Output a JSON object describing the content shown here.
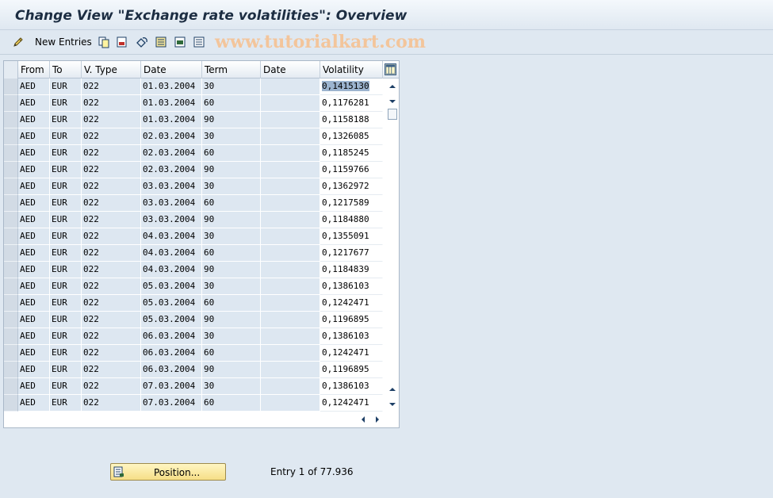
{
  "window": {
    "title": "Change View \"Exchange rate volatilities\": Overview"
  },
  "toolbar": {
    "new_entries_label": "New Entries",
    "watermark": "www.tutorialkart.com",
    "icons": [
      "edit-pencil-icon",
      "copy-icon",
      "delete-icon",
      "undo-icon",
      "select-all-icon",
      "select-block-icon",
      "deselect-all-icon"
    ]
  },
  "table": {
    "columns": [
      "From",
      "To",
      "V. Type",
      "Date",
      "Term",
      "Date",
      "Volatility"
    ],
    "rows": [
      [
        "AED",
        "EUR",
        "022",
        "01.03.2004",
        "30",
        "",
        "0,1415130"
      ],
      [
        "AED",
        "EUR",
        "022",
        "01.03.2004",
        "60",
        "",
        "0,1176281"
      ],
      [
        "AED",
        "EUR",
        "022",
        "01.03.2004",
        "90",
        "",
        "0,1158188"
      ],
      [
        "AED",
        "EUR",
        "022",
        "02.03.2004",
        "30",
        "",
        "0,1326085"
      ],
      [
        "AED",
        "EUR",
        "022",
        "02.03.2004",
        "60",
        "",
        "0,1185245"
      ],
      [
        "AED",
        "EUR",
        "022",
        "02.03.2004",
        "90",
        "",
        "0,1159766"
      ],
      [
        "AED",
        "EUR",
        "022",
        "03.03.2004",
        "30",
        "",
        "0,1362972"
      ],
      [
        "AED",
        "EUR",
        "022",
        "03.03.2004",
        "60",
        "",
        "0,1217589"
      ],
      [
        "AED",
        "EUR",
        "022",
        "03.03.2004",
        "90",
        "",
        "0,1184880"
      ],
      [
        "AED",
        "EUR",
        "022",
        "04.03.2004",
        "30",
        "",
        "0,1355091"
      ],
      [
        "AED",
        "EUR",
        "022",
        "04.03.2004",
        "60",
        "",
        "0,1217677"
      ],
      [
        "AED",
        "EUR",
        "022",
        "04.03.2004",
        "90",
        "",
        "0,1184839"
      ],
      [
        "AED",
        "EUR",
        "022",
        "05.03.2004",
        "30",
        "",
        "0,1386103"
      ],
      [
        "AED",
        "EUR",
        "022",
        "05.03.2004",
        "60",
        "",
        "0,1242471"
      ],
      [
        "AED",
        "EUR",
        "022",
        "05.03.2004",
        "90",
        "",
        "0,1196895"
      ],
      [
        "AED",
        "EUR",
        "022",
        "06.03.2004",
        "30",
        "",
        "0,1386103"
      ],
      [
        "AED",
        "EUR",
        "022",
        "06.03.2004",
        "60",
        "",
        "0,1242471"
      ],
      [
        "AED",
        "EUR",
        "022",
        "06.03.2004",
        "90",
        "",
        "0,1196895"
      ],
      [
        "AED",
        "EUR",
        "022",
        "07.03.2004",
        "30",
        "",
        "0,1386103"
      ],
      [
        "AED",
        "EUR",
        "022",
        "07.03.2004",
        "60",
        "",
        "0,1242471"
      ]
    ]
  },
  "footer": {
    "position_button_label": "Position...",
    "entry_text": "Entry 1 of 77.936"
  },
  "colors": {
    "background": "#dfe8f1",
    "table_cell": "#dde7f1",
    "button": "#f6de86",
    "selection": "#9cb4cf"
  }
}
